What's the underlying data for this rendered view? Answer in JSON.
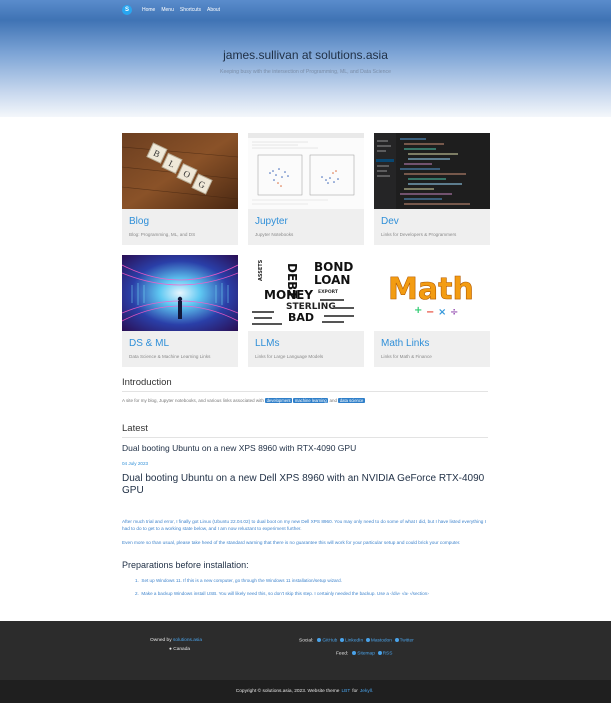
{
  "nav": {
    "brand_letter": "S",
    "links": [
      "Home",
      "Menu",
      "Shortcuts",
      "About"
    ]
  },
  "hero": {
    "title": "james.sullivan at solutions.asia",
    "subtitle": "Keeping busy with the intersection of Programming, ML, and Data Science"
  },
  "cards": [
    {
      "title": "Blog",
      "desc": "Blog: Programming, ML, and DS"
    },
    {
      "title": "Jupyter",
      "desc": "Jupyter Notebooks"
    },
    {
      "title": "Dev",
      "desc": "Links for Developers & Programmers"
    },
    {
      "title": "DS & ML",
      "desc": "Data Science & Machine Learning Links"
    },
    {
      "title": "LLMs",
      "desc": "Links for Large Language Models"
    },
    {
      "title": "Math Links",
      "desc": "Links for Math & Finance"
    }
  ],
  "card_images": {
    "blog_letters": [
      "B",
      "L",
      "O",
      "G"
    ],
    "math_word": "Math",
    "wordcloud": [
      "ASSETS",
      "BOND",
      "LOAN",
      "MONEY",
      "STERLING",
      "BAD",
      "DEBT",
      "EXPORT"
    ]
  },
  "intro": {
    "heading": "Introduction",
    "text_before": "A site for my blog, Jupyter notebooks, and various links associated with",
    "tags": [
      "development",
      "machine learning",
      "data science"
    ],
    "and": "and"
  },
  "latest": {
    "heading": "Latest",
    "post_title": "Dual booting Ubuntu on a new XPS 8960 with RTX-4090 GPU",
    "post_date": "04 July 2023",
    "article_title": "Dual booting Ubuntu on a new Dell XPS 8960 with an NVIDIA GeForce RTX-4090 GPU",
    "para1": "After much trial and error, I finally got Linux (Ubuntu 22.04.02) to dual boot on my new Dell XPS 8960. You may only need to do some of what I did, but I have listed everything I had to do to get to a working state below, and I am now reluctant to experiment further.",
    "para2": "Even more so than usual, please take heed of the standard warning that there is no guarantee this will work for your particular setup and could brick your computer.",
    "prep_heading": "Preparations before installation:",
    "steps": [
      "Set up Windows 11. If this is a new computer, go through the Windows 11 installation/setup wizard.",
      "Make a backup Windows install USB. You will likely need this, so don't skip this step. I certainly needed the backup. Use a ‹/div› ‹/a› ‹/section›"
    ]
  },
  "footer": {
    "owned_by": "Owned by",
    "owner": "solutions.asia",
    "location": "Canada",
    "social_label": "Social:",
    "social": [
      "GitHub",
      "LinkedIn",
      "Mastodon",
      "Twitter"
    ],
    "feed_label": "Feed:",
    "feeds": [
      "Sitemap",
      "RSS"
    ],
    "copyright_pre": "Copyright © solutions.asia, 2023. Website theme",
    "theme": "LBT",
    "for": "for",
    "engine": "Jekyll."
  },
  "colors": {
    "nav": "#3f73b4",
    "link": "#2f8fd8",
    "footer": "#2c2c2c"
  }
}
